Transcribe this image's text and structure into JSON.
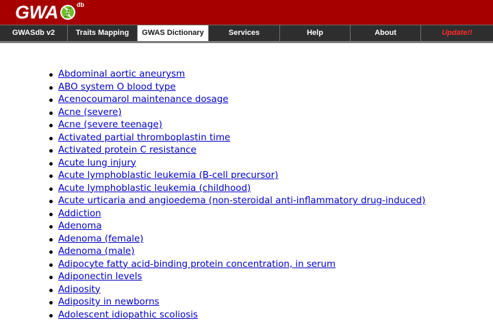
{
  "logo": {
    "text": "GWA",
    "superscript": "db",
    "accent_color": "#6fbf2a"
  },
  "colors": {
    "header_bg": "#a60000",
    "nav_bg": "#2e2e2e",
    "link": "#0000c8",
    "update": "#ff2a2a"
  },
  "nav": {
    "items": [
      {
        "label": "GWASdb v2",
        "active": false
      },
      {
        "label": "Traits Mapping",
        "active": false
      },
      {
        "label": "GWAS Dictionary",
        "active": true
      },
      {
        "label": "Services",
        "active": false
      },
      {
        "label": "Help",
        "active": false
      },
      {
        "label": "About",
        "active": false
      },
      {
        "label": "Update!!",
        "active": false
      }
    ]
  },
  "terms": [
    "Abdominal aortic aneurysm",
    "ABO system O blood type",
    "Acenocoumarol maintenance dosage",
    "Acne (severe)",
    "Acne (severe teenage)",
    "Activated partial thromboplastin time",
    "Activated protein C resistance",
    "Acute lung injury",
    "Acute lymphoblastic leukemia (B-cell precursor)",
    "Acute lymphoblastic leukemia (childhood)",
    "Acute urticaria and angioedema (non-steroidal anti-inflammatory drug-induced)",
    "Addiction",
    "Adenoma",
    "Adenoma (female)",
    "Adenoma (male)",
    "Adipocyte fatty acid-binding protein concentration, in serum",
    "Adiponectin levels",
    "Adiposity",
    "Adiposity in newborns",
    "Adolescent idiopathic scoliosis"
  ]
}
